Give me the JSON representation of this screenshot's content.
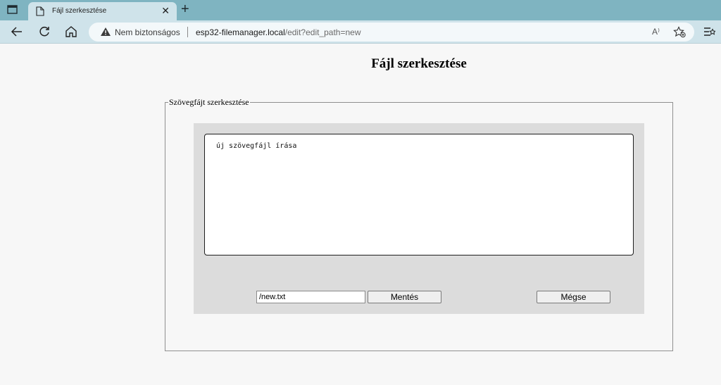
{
  "browser": {
    "tab_title": "Fájl szerkesztése",
    "tab_close": "✕",
    "new_tab": "+",
    "security_label": "Nem biztonságos",
    "url_host": "esp32-filemanager.local",
    "url_path": "/edit?edit_path=new",
    "read_aloud": "A⁾",
    "icons": [
      "tab-actions-icon",
      "document-icon",
      "back-icon",
      "refresh-icon",
      "home-icon",
      "warning-icon",
      "read-aloud-icon",
      "add-favorite-icon",
      "collections-icon"
    ]
  },
  "page": {
    "title": "Fájl szerkesztése",
    "fieldset_legend": "Szövegfájt szerkesztése",
    "editor_text": "új szövegfájl írása",
    "filename_value": "/new.txt",
    "save_label": "Mentés",
    "cancel_label": "Mégse"
  },
  "colors": {
    "tabbar": "#7fb4c1",
    "toolbar": "#cfe3ea",
    "page_bg": "#f7f7f7",
    "panel_bg": "#dcdcdc"
  }
}
